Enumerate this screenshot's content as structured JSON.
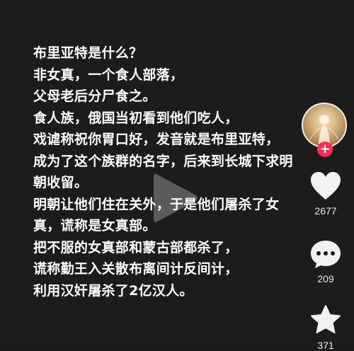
{
  "post": {
    "lines": [
      "布里亚特是什么？",
      "非女真，一个食人部落，",
      "父母老后分尸食之。",
      "食人族，俄国当初看到他们吃人，",
      "戏谑称祝你胃口好，发音就是布里亚特，",
      "成为了这个族群的名字，后来到长城下求明",
      "朝收留。",
      "明朝让他们住在关外，于是他们屠杀了女",
      "真，谎称是女真部。",
      "把不服的女真部和蒙古部都杀了，",
      "谎称勤王入关散布离间计反间计，",
      "利用汉奸屠杀了2亿汉人。"
    ]
  },
  "actions": {
    "like_count": "2677",
    "comment_count": "209",
    "favorite_count": "371"
  },
  "follow": {
    "label": "+"
  },
  "colors": {
    "background": "#1b1b1b",
    "follow_accent": "#fe2c55",
    "icon": "#ffffff"
  },
  "icons": {
    "play": "play-icon",
    "like": "heart-icon",
    "comment": "comment-icon",
    "favorite": "star-icon"
  }
}
